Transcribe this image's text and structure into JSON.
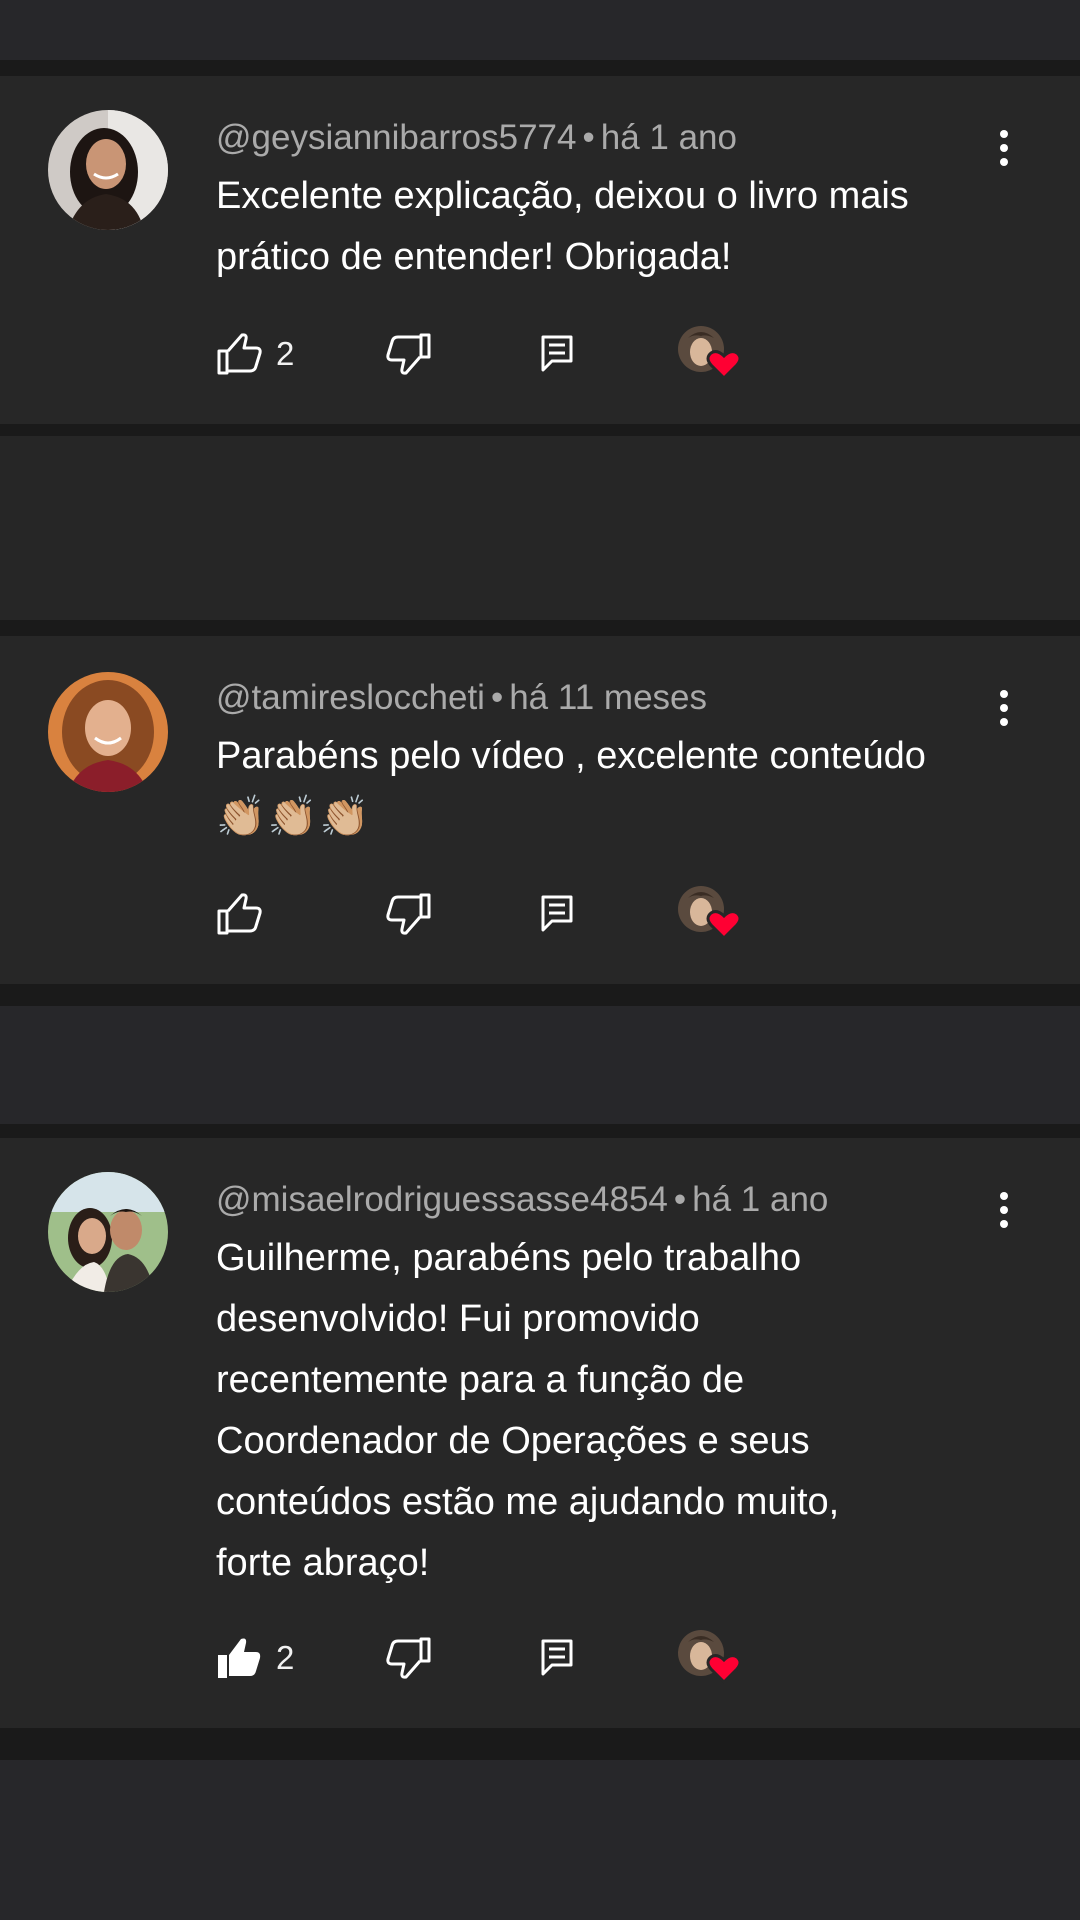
{
  "colors": {
    "background": "#272727",
    "separator": "#1a1a1a",
    "meta_text": "#aaaaaa",
    "body_text": "#ffffff",
    "heart": "#ff0033"
  },
  "comments": [
    {
      "author": "@geysiannibarros5774",
      "time": "há 1 ano",
      "text_lines": [
        "Excelente explicação, deixou o livro mais",
        "prático de entender! Obrigada!"
      ],
      "likes": "2",
      "liked": false,
      "creator_heart": true
    },
    {
      "author": "@tamiresloccheti",
      "time": "há 11 meses",
      "text_lines": [
        "Parabéns pelo vídeo , excelente conteúdo",
        "👏🏼👏🏼👏🏼"
      ],
      "likes": "",
      "liked": false,
      "creator_heart": true
    },
    {
      "author": "@misaelrodriguessasse4854",
      "time": "há 1 ano",
      "text_lines": [
        "Guilherme, parabéns pelo trabalho",
        "desenvolvido! Fui promovido",
        "recentemente para a função de",
        "Coordenador de Operações e seus",
        "conteúdos estão me ajudando muito,",
        "forte abraço!"
      ],
      "likes": "2",
      "liked": true,
      "creator_heart": true
    }
  ],
  "icons": {
    "like": "thumb-up-icon",
    "like_filled": "thumb-up-filled-icon",
    "dislike": "thumb-down-icon",
    "reply": "reply-comment-icon",
    "menu": "more-vert-icon",
    "heart": "creator-heart-icon"
  }
}
